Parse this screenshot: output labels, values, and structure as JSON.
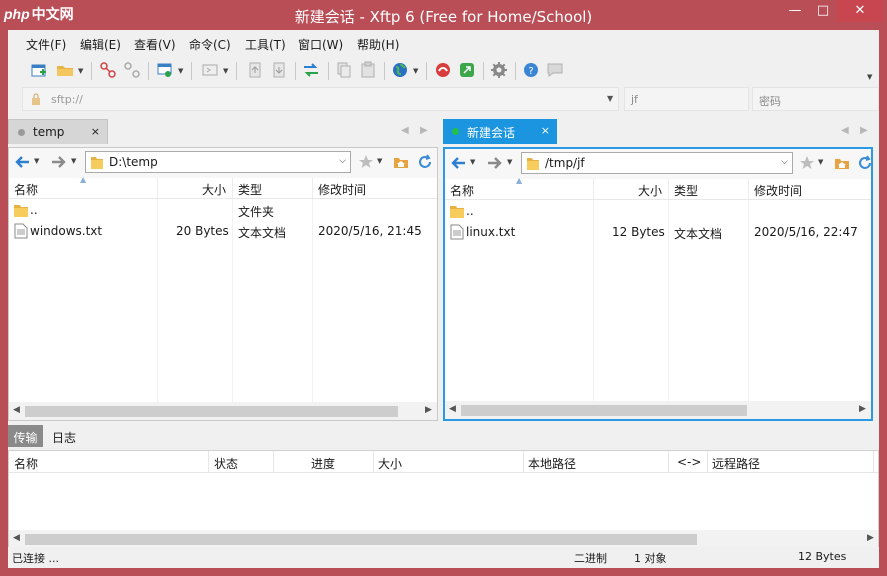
{
  "titlebar": {
    "logo_en": "php",
    "logo_cn": "中文网",
    "title": "新建会话 - Xftp 6 (Free for Home/School)",
    "min": "—",
    "max": "□",
    "close": "✕"
  },
  "menu": [
    {
      "label": "文件(F)"
    },
    {
      "label": "编辑(E)"
    },
    {
      "label": "查看(V)"
    },
    {
      "label": "命令(C)"
    },
    {
      "label": "工具(T)"
    },
    {
      "label": "窗口(W)"
    },
    {
      "label": "帮助(H)"
    }
  ],
  "address": {
    "placeholder": "sftp://",
    "user": "jf",
    "password_placeholder": "密码"
  },
  "left_pane": {
    "tab_label": "temp",
    "tab_close": "×",
    "path": "D:\\temp",
    "columns": [
      "名称",
      "大小",
      "类型",
      "修改时间"
    ],
    "rows": [
      {
        "name": "..",
        "size": "",
        "type": "文件夹",
        "modified": ""
      },
      {
        "name": "windows.txt",
        "size": "20 Bytes",
        "type": "文本文档",
        "modified": "2020/5/16, 21:45"
      }
    ]
  },
  "right_pane": {
    "tab_label": "新建会话",
    "tab_close": "×",
    "path": "/tmp/jf",
    "columns": [
      "名称",
      "大小",
      "类型",
      "修改时间"
    ],
    "rows": [
      {
        "name": "..",
        "size": "",
        "type": "",
        "modified": ""
      },
      {
        "name": "linux.txt",
        "size": "12 Bytes",
        "type": "文本文档",
        "modified": "2020/5/16, 22:47"
      }
    ]
  },
  "bottom": {
    "tabs": [
      "传输",
      "日志"
    ],
    "columns": [
      "名称",
      "状态",
      "进度",
      "大小",
      "本地路径",
      "<->",
      "远程路径"
    ]
  },
  "status": {
    "connection": "已连接 ...",
    "mode": "二进制",
    "objects": "1 对象",
    "size": "12 Bytes"
  },
  "colors": {
    "title_bar": "#ba4e57",
    "active_tab": "#1b95e0",
    "connected_dot": "#22c04a"
  }
}
